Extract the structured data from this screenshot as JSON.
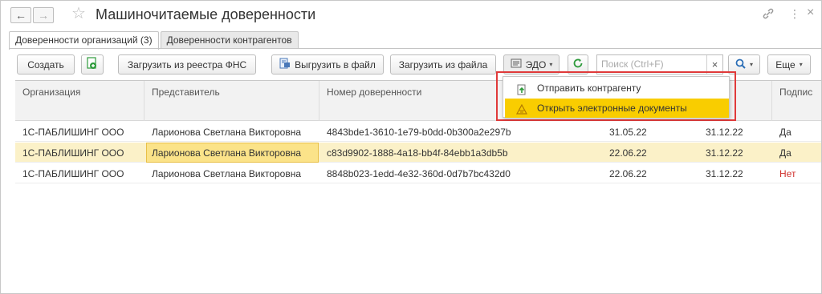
{
  "window": {
    "title": "Машиночитаемые доверенности",
    "back_icon": "←",
    "forward_icon": "→",
    "star_icon": "☆",
    "link_icon": "🔗",
    "more_icon": "⋮",
    "close_icon": "×"
  },
  "tabs": [
    {
      "label": "Доверенности организаций (3)",
      "active": true
    },
    {
      "label": "Доверенности контрагентов",
      "active": false
    }
  ],
  "toolbar": {
    "create_label": "Создать",
    "import_fns_label": "Загрузить из реестра ФНС",
    "export_file_label": "Выгрузить в файл",
    "import_file_label": "Загрузить из файла",
    "edo_label": "ЭДО",
    "search_placeholder": "Поиск (Ctrl+F)",
    "search_clear": "×",
    "more_label": "Еще"
  },
  "table": {
    "columns": [
      "Организация",
      "Представитель",
      "Номер доверенности",
      "Подпис"
    ],
    "rows": [
      {
        "org": "1С-ПАБЛИШИНГ ООО",
        "rep": "Ларионова Светлана Викторовна",
        "number": "4843bde1-3610-1e79-b0dd-0b300a2e297b",
        "date_from": "31.05.22",
        "date_to": "31.12.22",
        "signed": "Да"
      },
      {
        "org": "1С-ПАБЛИШИНГ ООО",
        "rep": "Ларионова Светлана Викторовна",
        "number": "c83d9902-1888-4a18-bb4f-84ebb1a3db5b",
        "date_from": "22.06.22",
        "date_to": "31.12.22",
        "signed": "Да"
      },
      {
        "org": "1С-ПАБЛИШИНГ ООО",
        "rep": "Ларионова Светлана Викторовна",
        "number": "8848b023-1edd-4e32-360d-0d7b7bc432d0",
        "date_from": "22.06.22",
        "date_to": "31.12.22",
        "signed": "Нет"
      }
    ]
  },
  "edo_menu": {
    "items": [
      {
        "label": "Отправить контрагенту",
        "icon": "send-document-icon"
      },
      {
        "label": "Открыть электронные документы",
        "icon": "edo-documents-icon",
        "highlighted": true
      }
    ]
  },
  "colors": {
    "highlight": "#f9cd00",
    "selected_row": "#fbf1c8",
    "accent_green": "#2e9b3c",
    "no_red": "#d0312d",
    "frame_red": "#e03a3a"
  }
}
